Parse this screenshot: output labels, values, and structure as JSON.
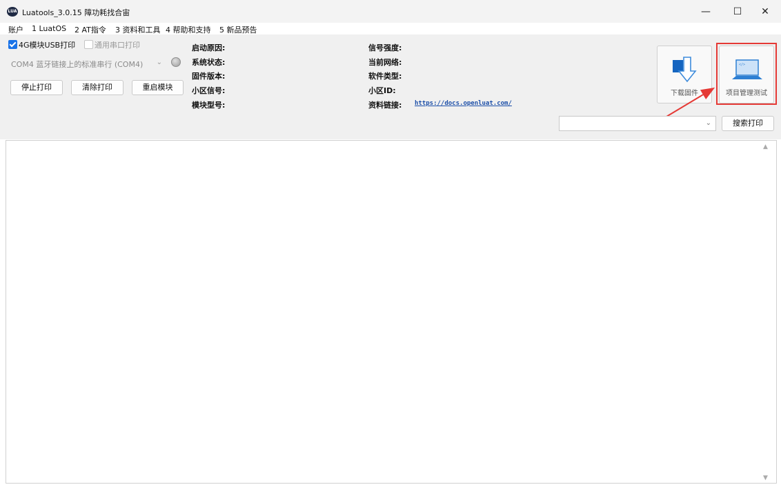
{
  "window": {
    "title": "Luatools_3.0.15 障功耗找合宙",
    "icon": "luatools-app-icon",
    "controls": {
      "minimize": "—",
      "maximize": "☐",
      "close": "✕"
    }
  },
  "menu": [
    "账户",
    "1 LuatOS",
    "2 AT指令",
    "3 资料和工具",
    "4 帮助和支持",
    "5 新品预告"
  ],
  "options": {
    "usb_print": {
      "label": "4G模块USB打印",
      "checked": true
    },
    "serial_print": {
      "label": "通用串口打印",
      "checked": false
    }
  },
  "port": {
    "value": "COM4 蓝牙链接上的标准串行 (COM4)"
  },
  "buttons": {
    "stop": "停止打印",
    "clear": "清除打印",
    "restart": "重启模块"
  },
  "info": {
    "boot_reason": "启动原因:",
    "system_state": "系统状态:",
    "firmware_version": "固件版本:",
    "cell_signal": "小区信号:",
    "module_model": "模块型号:",
    "signal_strength": "信号强度:",
    "current_network": "当前网络:",
    "software_type": "软件类型:",
    "cell_id": "小区ID:",
    "docs_link": "资料链接:",
    "docs_url": "https://docs.openluat.com/"
  },
  "tools": {
    "download": "下载固件",
    "project": "项目管理测试"
  },
  "search": {
    "value": "",
    "button": "搜索打印"
  },
  "colors": {
    "accent": "#1a73e8",
    "highlight": "#e53935",
    "link": "#1b4ea8"
  }
}
